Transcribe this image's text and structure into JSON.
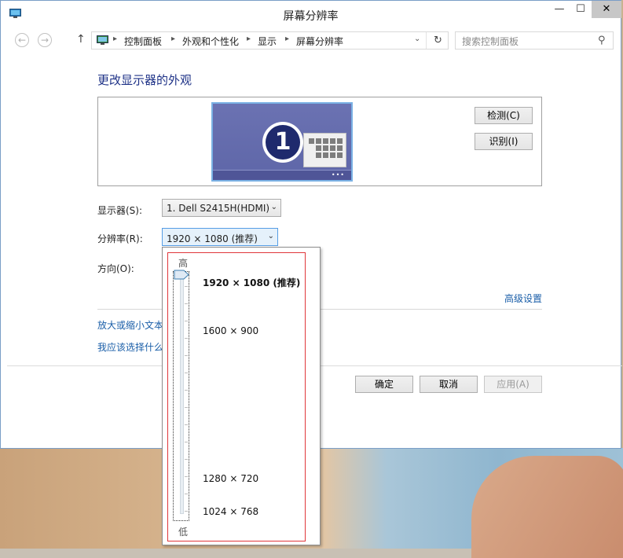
{
  "window": {
    "title": "屏幕分辨率",
    "controls": {
      "minimize": "—",
      "maximize": "☐",
      "close": "✕"
    }
  },
  "nav": {
    "back": "←",
    "forward": "→",
    "up": "↑",
    "breadcrumbs": [
      "控制面板",
      "外观和个性化",
      "显示",
      "屏幕分辨率"
    ],
    "breadcrumb_sep": "▸",
    "dropdown_arrow": "⌄",
    "refresh": "↻",
    "search_placeholder": "搜索控制面板",
    "search_glyph": "⚲"
  },
  "main": {
    "heading": "更改显示器的外观",
    "monitor_number": "1",
    "monitor_dots": "•••",
    "detect_button": "检测(C)",
    "identify_button": "识别(I)",
    "display_label": "显示器(S):",
    "display_value": "1. Dell S2415H(HDMI)",
    "resolution_label": "分辨率(R):",
    "resolution_value": "1920 × 1080 (推荐)",
    "orientation_label": "方向(O):",
    "advanced_link": "高级设置",
    "link_text_size": "放大或缩小文本",
    "link_choose": "我应该选择什么",
    "select_arrow": "⌄"
  },
  "footer": {
    "ok": "确定",
    "cancel": "取消",
    "apply": "应用(A)"
  },
  "resolution_dropdown": {
    "high_label": "高",
    "low_label": "低",
    "options": [
      {
        "label": "1920 × 1080 (推荐)",
        "selected": true
      },
      {
        "label": "1600 × 900",
        "selected": false
      },
      {
        "label": "1280 × 720",
        "selected": false
      },
      {
        "label": "1024 × 768",
        "selected": false
      }
    ]
  },
  "colors": {
    "heading": "#1e3287",
    "link": "#1a5ea8",
    "highlight_border": "#e0363a",
    "monitor_bg": "#6b72b2"
  }
}
